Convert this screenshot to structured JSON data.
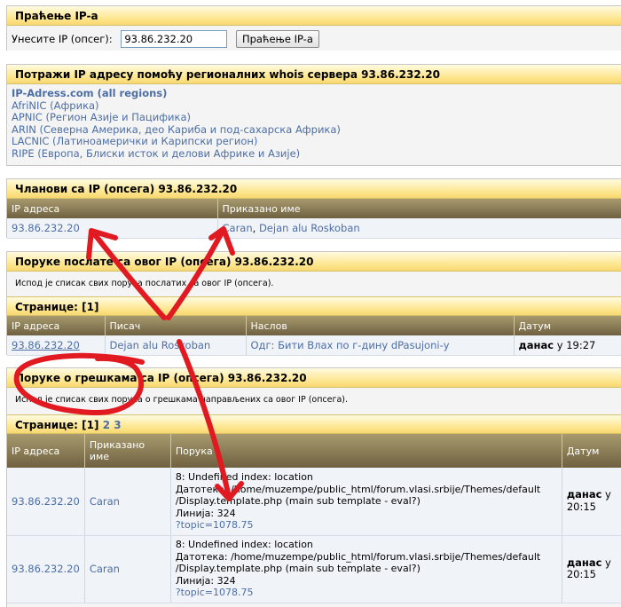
{
  "track": {
    "title": "Праћење IP-а",
    "label": "Унесите IP (опсег):",
    "value": "93.86.232.20",
    "button": "Праћење IP-а"
  },
  "whois": {
    "title": "Потражи IP адресу помоћу регионалних whois сервера 93.86.232.20",
    "items": [
      "IP-Adress.com (all regions)",
      "AfriNIC (Африка)",
      "APNIC (Регион Азије и Пацифика)",
      "ARIN (Северна Америка, део Кариба и под-сахарска Африка)",
      "LACNIC (Латиноамерички и Карипски регион)",
      "RIPE (Европа, Блиски исток и делови Африке и Азије)"
    ]
  },
  "members": {
    "title": "Чланови са IP (опсега) 93.86.232.20",
    "headers": [
      "IP адреса",
      "Приказано име"
    ],
    "row": {
      "ip": "93.86.232.20",
      "name1": "Caran",
      "sep": ", ",
      "name2": "Dejan alu Roskoban"
    }
  },
  "posts": {
    "title": "Поруке послате са овог IP (опсега) 93.86.232.20",
    "desc": "Испод је списак свих порука послатих са овог IP (опсега).",
    "pages_label": "Странице:",
    "pages": "[1]",
    "headers": [
      "IP адреса",
      "Писач",
      "Наслов",
      "Датум"
    ],
    "row": {
      "ip": "93.86.232.20",
      "author": "Dejan alu Roskoban",
      "subject": "Одг: Бити Влах по г-дину dPasujoni-у",
      "date_bold": "данас",
      "date_rest": " у 19:27"
    }
  },
  "errors": {
    "title": "Поруке о грешкама са IP (опсега) 93.86.232.20",
    "desc": "Испод је списак свих порука о грешкама направљених са овог IP (опсега).",
    "pages_label": "Странице:",
    "pages": [
      "[1]",
      "2",
      "3"
    ],
    "headers": [
      "IP адреса",
      "Приказано име",
      "Порука",
      "Датум"
    ],
    "rows": [
      {
        "ip": "93.86.232.20",
        "name": "Caran",
        "msg1": "8: Undefined index: location",
        "msg2": "Датотека: /home/muzempe/public_html/forum.vlasi.srbije/Themes/default",
        "msg3": "/Display.template.php (main sub template - eval?)",
        "msg4": "Линија: 324",
        "link": "?topic=1078.75",
        "date_bold": "данас",
        "date_rest": " у 20:15"
      },
      {
        "ip": "93.86.232.20",
        "name": "Caran",
        "msg1": "8: Undefined index: location",
        "msg2": "Датотека: /home/muzempe/public_html/forum.vlasi.srbije/Themes/default",
        "msg3": "/Display.template.php (main sub template - eval?)",
        "msg4": "Линија: 324",
        "link": "?topic=1078.75",
        "date_bold": "данас",
        "date_rest": " у 20:15"
      }
    ]
  },
  "colors": {
    "annotation": "#e11a22",
    "link": "#4d6ea5",
    "header_gold": "#fde58c",
    "title_bg": "#8a7c56"
  }
}
